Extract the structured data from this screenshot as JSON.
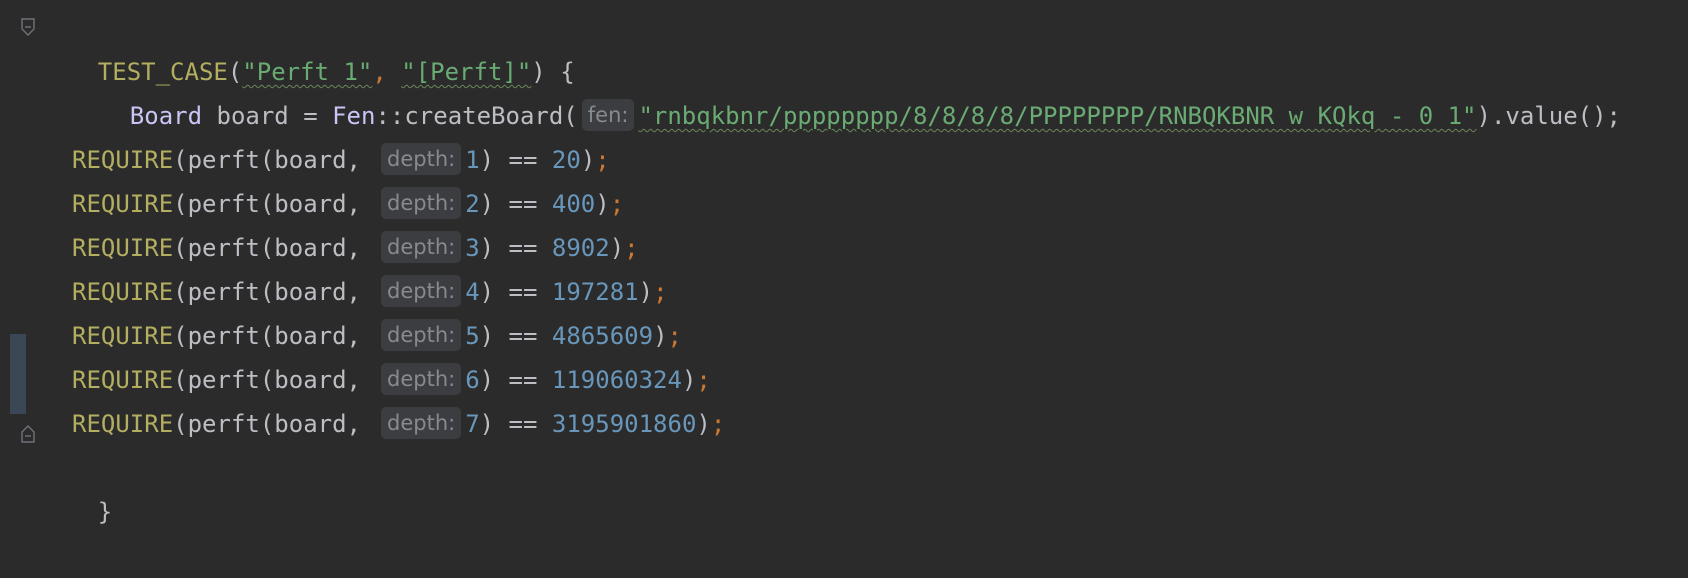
{
  "code": {
    "line1": {
      "fn": "TEST_CASE",
      "open": "(",
      "str1": "\"Perft 1\"",
      "comma": ", ",
      "str2": "\"[Perft]\"",
      "close": ") {"
    },
    "line2": {
      "type": "Board",
      "var": " board = ",
      "ns": "Fen",
      "call": "::createBoard(",
      "hint": "fen:",
      "str": "\"rnbqkbnr/pppppppp/8/8/8/8/PPPPPPPP/RNBQKBNR w KQkq - 0 1\"",
      "tail": ").value();"
    },
    "requires": [
      {
        "fn": "REQUIRE",
        "pre": "(perft(board,",
        "hint": "depth:",
        "depth": "1",
        "op": ") == ",
        "value": "20",
        "end": ")",
        "semi": ";"
      },
      {
        "fn": "REQUIRE",
        "pre": "(perft(board,",
        "hint": "depth:",
        "depth": "2",
        "op": ") == ",
        "value": "400",
        "end": ")",
        "semi": ";"
      },
      {
        "fn": "REQUIRE",
        "pre": "(perft(board,",
        "hint": "depth:",
        "depth": "3",
        "op": ") == ",
        "value": "8902",
        "end": ")",
        "semi": ";"
      },
      {
        "fn": "REQUIRE",
        "pre": "(perft(board,",
        "hint": "depth:",
        "depth": "4",
        "op": ") == ",
        "value": "197281",
        "end": ")",
        "semi": ";"
      },
      {
        "fn": "REQUIRE",
        "pre": "(perft(board,",
        "hint": "depth:",
        "depth": "5",
        "op": ") == ",
        "value": "4865609",
        "end": ")",
        "semi": ";"
      },
      {
        "fn": "REQUIRE",
        "pre": "(perft(board,",
        "hint": "depth:",
        "depth": "6",
        "op": ") == ",
        "value": "119060324",
        "end": ")",
        "semi": ";"
      },
      {
        "fn": "REQUIRE",
        "pre": "(perft(board,",
        "hint": "depth:",
        "depth": "7",
        "op": ") == ",
        "value": "3195901860",
        "end": ")",
        "semi": ";"
      }
    ],
    "closing": "}"
  },
  "colors": {
    "background": "#2b2b2b",
    "function": "#b3ae60",
    "string": "#6aab73",
    "number": "#6897bb",
    "semicolon": "#cc7832",
    "type": "#c9c5f5",
    "hint_bg": "#3b3d40"
  },
  "icons": {
    "fold_start": "fold-open-icon",
    "fold_end": "fold-close-icon"
  }
}
